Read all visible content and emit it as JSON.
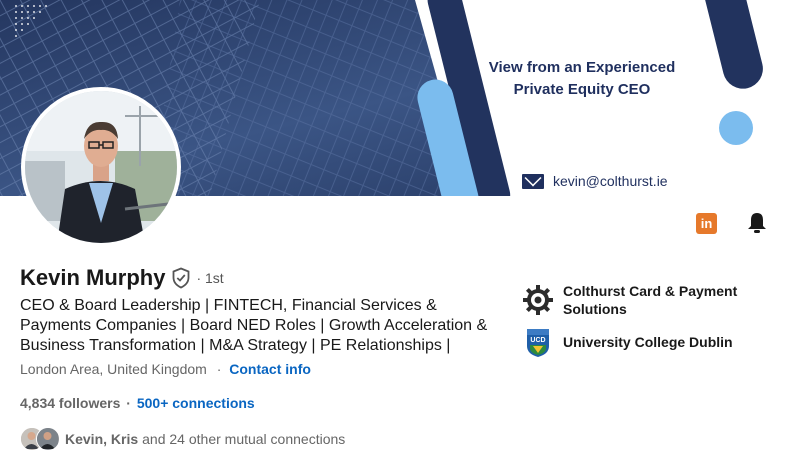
{
  "banner": {
    "tagline_line1": "View from an Experienced",
    "tagline_line2": "Private Equity CEO",
    "email": "kevin@colthurst.ie",
    "accent_color": "#7bbcee",
    "dark_color": "#1f2f5e"
  },
  "profile": {
    "name": "Kevin Murphy",
    "degree": "· 1st",
    "headline": "CEO & Board Leadership | FINTECH, Financial Services & Payments Companies | Board NED Roles | Growth Acceleration & Business Transformation | M&A Strategy | PE Relationships |",
    "location": "London Area, United Kingdom",
    "location_separator": "·",
    "contact_info": "Contact info",
    "followers": "4,834 followers",
    "stats_separator": "·",
    "connections": "500+ connections",
    "mutual_names": "Kevin, Kris",
    "mutual_rest": "and 24 other mutual connections"
  },
  "experience": {
    "company": "Colthurst Card & Payment Solutions",
    "school": "University College Dublin"
  },
  "actions": {
    "linkedin_icon_text": "in",
    "linkedin_color": "#e6792b",
    "link_color": "#0a66c2"
  }
}
